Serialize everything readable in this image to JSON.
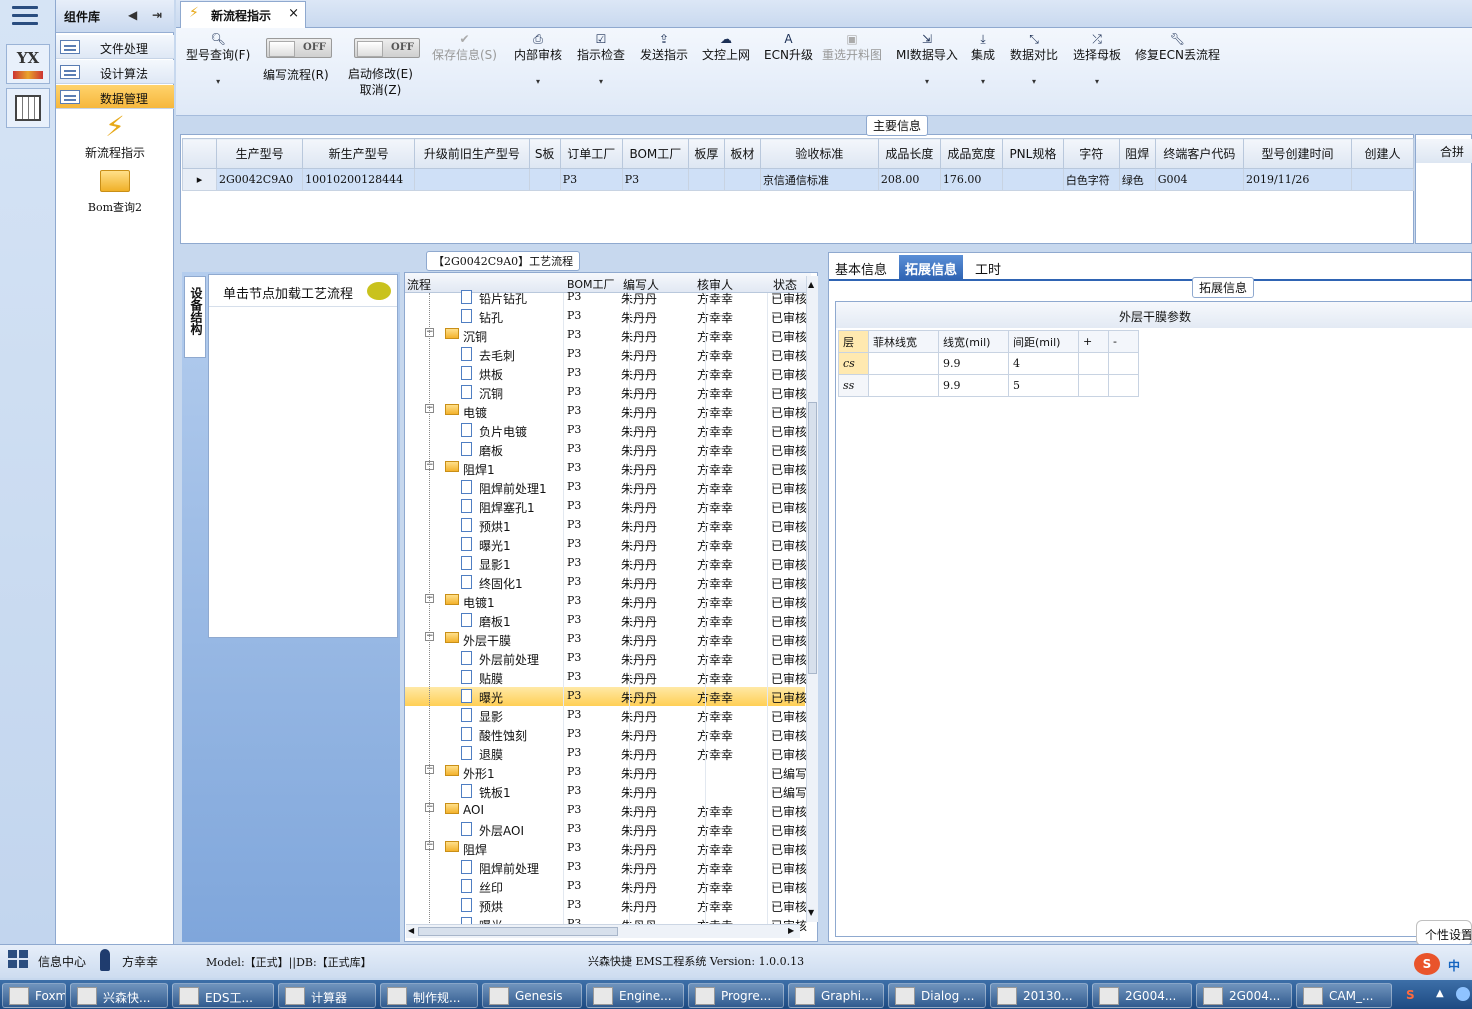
{
  "sidebar": {
    "component_library": "组件库",
    "items": [
      {
        "label": "文件处理"
      },
      {
        "label": "设计算法"
      },
      {
        "label": "数据管理"
      }
    ],
    "big_items": [
      {
        "label": "新流程指示"
      },
      {
        "label": "Bom查询2"
      }
    ],
    "rail_label": "YX"
  },
  "tab": {
    "title": "新流程指示",
    "close": "×"
  },
  "toolbar": {
    "buttons": [
      {
        "label": "型号查询(F)",
        "dd": "▾"
      },
      {
        "label": "编写流程(R)",
        "toggle": "OFF"
      },
      {
        "label": "启动修改(E)",
        "label2": "取消(Z)",
        "toggle": "OFF"
      },
      {
        "label": "保存信息(S)"
      },
      {
        "label": "内部审核",
        "dd": "▾"
      },
      {
        "label": "指示检查",
        "dd": "▾"
      },
      {
        "label": "发送指示"
      },
      {
        "label": "文控上网"
      },
      {
        "label": "ECN升级"
      },
      {
        "label": "重选开料图"
      },
      {
        "label": "MI数据导入",
        "dd": "▾"
      },
      {
        "label": "集成",
        "dd": "▾"
      },
      {
        "label": "数据对比",
        "dd": "▾"
      },
      {
        "label": "选择母板",
        "dd": "▾"
      },
      {
        "label": "修复ECN丢流程"
      }
    ]
  },
  "main_info": {
    "title": "主要信息",
    "merge": "合拼",
    "headers": [
      "生产型号",
      "新生产型号",
      "升级前旧生产型号",
      "S板",
      "订单工厂",
      "BOM工厂",
      "板厚",
      "板材",
      "验收标准",
      "成品长度",
      "成品宽度",
      "PNL规格",
      "字符",
      "阻焊",
      "终端客户代码",
      "型号创建时间",
      "创建人"
    ],
    "row": [
      "2G0042C9A0",
      "10010200128444",
      "",
      "",
      "P3",
      "P3",
      "",
      "",
      "京信通信标准",
      "208.00",
      "176.00",
      "",
      "白色字符",
      "绿色",
      "G004",
      "2019/11/26",
      ""
    ]
  },
  "process": {
    "title": "【2G0042C9A0】工艺流程",
    "vtab": "设备结构",
    "node_hint": "单击节点加载工艺流程",
    "headers": {
      "flow": "流程",
      "bom": "BOM工厂",
      "writer": "编写人",
      "checker": "核审人",
      "status": "状态"
    },
    "rows": [
      {
        "name": "铅片钻孔",
        "level": 2,
        "bom": "P3",
        "w": "朱丹丹",
        "c": "方幸幸",
        "s": "已审核"
      },
      {
        "name": "钻孔",
        "level": 2,
        "bom": "P3",
        "w": "朱丹丹",
        "c": "方幸幸",
        "s": "已审核"
      },
      {
        "name": "沉铜",
        "level": 1,
        "bom": "P3",
        "w": "朱丹丹",
        "c": "方幸幸",
        "s": "已审核"
      },
      {
        "name": "去毛刺",
        "level": 2,
        "bom": "P3",
        "w": "朱丹丹",
        "c": "方幸幸",
        "s": "已审核"
      },
      {
        "name": "烘板",
        "level": 2,
        "bom": "P3",
        "w": "朱丹丹",
        "c": "方幸幸",
        "s": "已审核"
      },
      {
        "name": "沉铜",
        "level": 2,
        "bom": "P3",
        "w": "朱丹丹",
        "c": "方幸幸",
        "s": "已审核"
      },
      {
        "name": "电镀",
        "level": 1,
        "bom": "P3",
        "w": "朱丹丹",
        "c": "方幸幸",
        "s": "已审核"
      },
      {
        "name": "负片电镀",
        "level": 2,
        "bom": "P3",
        "w": "朱丹丹",
        "c": "方幸幸",
        "s": "已审核"
      },
      {
        "name": "磨板",
        "level": 2,
        "bom": "P3",
        "w": "朱丹丹",
        "c": "方幸幸",
        "s": "已审核"
      },
      {
        "name": "阻焊1",
        "level": 1,
        "bom": "P3",
        "w": "朱丹丹",
        "c": "方幸幸",
        "s": "已审核"
      },
      {
        "name": "阻焊前处理1",
        "level": 2,
        "bom": "P3",
        "w": "朱丹丹",
        "c": "方幸幸",
        "s": "已审核"
      },
      {
        "name": "阻焊塞孔1",
        "level": 2,
        "bom": "P3",
        "w": "朱丹丹",
        "c": "方幸幸",
        "s": "已审核"
      },
      {
        "name": "预烘1",
        "level": 2,
        "bom": "P3",
        "w": "朱丹丹",
        "c": "方幸幸",
        "s": "已审核"
      },
      {
        "name": "曝光1",
        "level": 2,
        "bom": "P3",
        "w": "朱丹丹",
        "c": "方幸幸",
        "s": "已审核"
      },
      {
        "name": "显影1",
        "level": 2,
        "bom": "P3",
        "w": "朱丹丹",
        "c": "方幸幸",
        "s": "已审核"
      },
      {
        "name": "终固化1",
        "level": 2,
        "bom": "P3",
        "w": "朱丹丹",
        "c": "方幸幸",
        "s": "已审核"
      },
      {
        "name": "电镀1",
        "level": 1,
        "bom": "P3",
        "w": "朱丹丹",
        "c": "方幸幸",
        "s": "已审核"
      },
      {
        "name": "磨板1",
        "level": 2,
        "bom": "P3",
        "w": "朱丹丹",
        "c": "方幸幸",
        "s": "已审核"
      },
      {
        "name": "外层干膜",
        "level": 1,
        "bom": "P3",
        "w": "朱丹丹",
        "c": "方幸幸",
        "s": "已审核"
      },
      {
        "name": "外层前处理",
        "level": 2,
        "bom": "P3",
        "w": "朱丹丹",
        "c": "方幸幸",
        "s": "已审核"
      },
      {
        "name": "贴膜",
        "level": 2,
        "bom": "P3",
        "w": "朱丹丹",
        "c": "方幸幸",
        "s": "已审核"
      },
      {
        "name": "曝光",
        "level": 2,
        "bom": "P3",
        "w": "朱丹丹",
        "c": "方幸幸",
        "s": "已审核",
        "selected": true
      },
      {
        "name": "显影",
        "level": 2,
        "bom": "P3",
        "w": "朱丹丹",
        "c": "方幸幸",
        "s": "已审核"
      },
      {
        "name": "酸性蚀刻",
        "level": 2,
        "bom": "P3",
        "w": "朱丹丹",
        "c": "方幸幸",
        "s": "已审核"
      },
      {
        "name": "退膜",
        "level": 2,
        "bom": "P3",
        "w": "朱丹丹",
        "c": "方幸幸",
        "s": "已审核"
      },
      {
        "name": "外形1",
        "level": 1,
        "bom": "P3",
        "w": "朱丹丹",
        "c": "",
        "s": "已编写"
      },
      {
        "name": "铣板1",
        "level": 2,
        "bom": "P3",
        "w": "朱丹丹",
        "c": "",
        "s": "已编写"
      },
      {
        "name": "AOI",
        "level": 1,
        "bom": "P3",
        "w": "朱丹丹",
        "c": "方幸幸",
        "s": "已审核"
      },
      {
        "name": "外层AOI",
        "level": 2,
        "bom": "P3",
        "w": "朱丹丹",
        "c": "方幸幸",
        "s": "已审核"
      },
      {
        "name": "阻焊",
        "level": 1,
        "bom": "P3",
        "w": "朱丹丹",
        "c": "方幸幸",
        "s": "已审核"
      },
      {
        "name": "阻焊前处理",
        "level": 2,
        "bom": "P3",
        "w": "朱丹丹",
        "c": "方幸幸",
        "s": "已审核"
      },
      {
        "name": "丝印",
        "level": 2,
        "bom": "P3",
        "w": "朱丹丹",
        "c": "方幸幸",
        "s": "已审核"
      },
      {
        "name": "预烘",
        "level": 2,
        "bom": "P3",
        "w": "朱丹丹",
        "c": "方幸幸",
        "s": "已审核"
      },
      {
        "name": "曝光",
        "level": 2,
        "bom": "P3",
        "w": "朱丹丹",
        "c": "方幸幸",
        "s": "已审核"
      }
    ]
  },
  "right": {
    "tabs": [
      "基本信息",
      "拓展信息",
      "工时"
    ],
    "group": "拓展信息",
    "title": "外层干膜参数",
    "headers": [
      "层",
      "菲林线宽",
      "线宽(mil)",
      "间距(mil)",
      "+",
      "-"
    ],
    "rows": [
      [
        "cs",
        "",
        "9.9",
        "4",
        "",
        ""
      ],
      [
        "ss",
        "",
        "9.9",
        "5",
        "",
        ""
      ]
    ]
  },
  "status": {
    "info": "信息中心",
    "user": "方幸幸",
    "model": "Model:【正式】||DB:【正式库】",
    "system": "兴森快捷 EMS工程系统 Version: 1.0.0.13",
    "personal": "个性设置",
    "ime": "中"
  },
  "taskbar": [
    "Foxmail",
    "兴森快...",
    "EDS工...",
    "计算器",
    "制作规...",
    "Genesis",
    "Engine...",
    "Progre...",
    "Graphi...",
    "Dialog ...",
    "20130...",
    "2G004...",
    "2G004...",
    "CAM_..."
  ]
}
